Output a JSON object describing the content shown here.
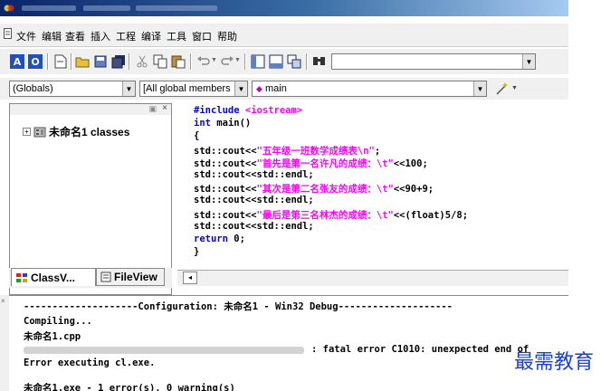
{
  "titlebar": {
    "title": ""
  },
  "menubar": {
    "items": [
      "文件",
      "编辑",
      "查看",
      "插入",
      "工程",
      "编译",
      "工具",
      "窗口",
      "帮助"
    ]
  },
  "wizard": {
    "class_combo": "(Globals)",
    "filter_combo": "[All global members",
    "member_combo": "main"
  },
  "workspace": {
    "tree_root": "未命名1 classes",
    "tab_class": "ClassV...",
    "tab_file": "FileView"
  },
  "editor": {
    "lines": [
      [
        {
          "t": "#include ",
          "c": "pp"
        },
        {
          "t": "<iostream>",
          "c": "str"
        }
      ],
      [
        {
          "t": "int ",
          "c": "kw"
        },
        {
          "t": "main()",
          "c": ""
        }
      ],
      [
        {
          "t": "{",
          "c": ""
        }
      ],
      [
        {
          "t": "std::cout<<",
          "c": ""
        },
        {
          "t": "\"五年级一班数学成绩表\\n\"",
          "c": "str"
        },
        {
          "t": ";",
          "c": ""
        }
      ],
      [
        {
          "t": "std::cout<<",
          "c": ""
        },
        {
          "t": "\"首先是第一名许凡的成绩：\\t\"",
          "c": "str"
        },
        {
          "t": "<<100;",
          "c": ""
        }
      ],
      [
        {
          "t": "std::cout<<std::endl;",
          "c": ""
        }
      ],
      [
        {
          "t": "std::cout<<",
          "c": ""
        },
        {
          "t": "\"其次是第二名张友的成绩：\\t\"",
          "c": "str"
        },
        {
          "t": "<<90+9;",
          "c": ""
        }
      ],
      [
        {
          "t": "std::cout<<std::endl;",
          "c": ""
        }
      ],
      [
        {
          "t": "std::cout<<",
          "c": ""
        },
        {
          "t": "\"最后是第三名林杰的成绩：\\t\"",
          "c": "str"
        },
        {
          "t": "<<(float)5/8;",
          "c": ""
        }
      ],
      [
        {
          "t": "std::cout<<std::endl;",
          "c": ""
        }
      ],
      [
        {
          "t": "return ",
          "c": "kw"
        },
        {
          "t": "0;",
          "c": ""
        }
      ],
      [
        {
          "t": "}",
          "c": ""
        }
      ]
    ]
  },
  "output": {
    "config_line": "--------------------Configuration: 未命名1 - Win32 Debug--------------------",
    "compiling": "Compiling...",
    "file": "未命名1.cpp",
    "error_line": ": fatal error C1010: unexpected end of",
    "exec_error": "Error executing cl.exe.",
    "result": "未命名1.exe - 1 error(s), 0 warning(s)"
  },
  "watermark": "最需教育",
  "colors": {
    "string": "#ff00ff",
    "keyword": "#0000ff",
    "watermark": "#1a3fd4"
  }
}
